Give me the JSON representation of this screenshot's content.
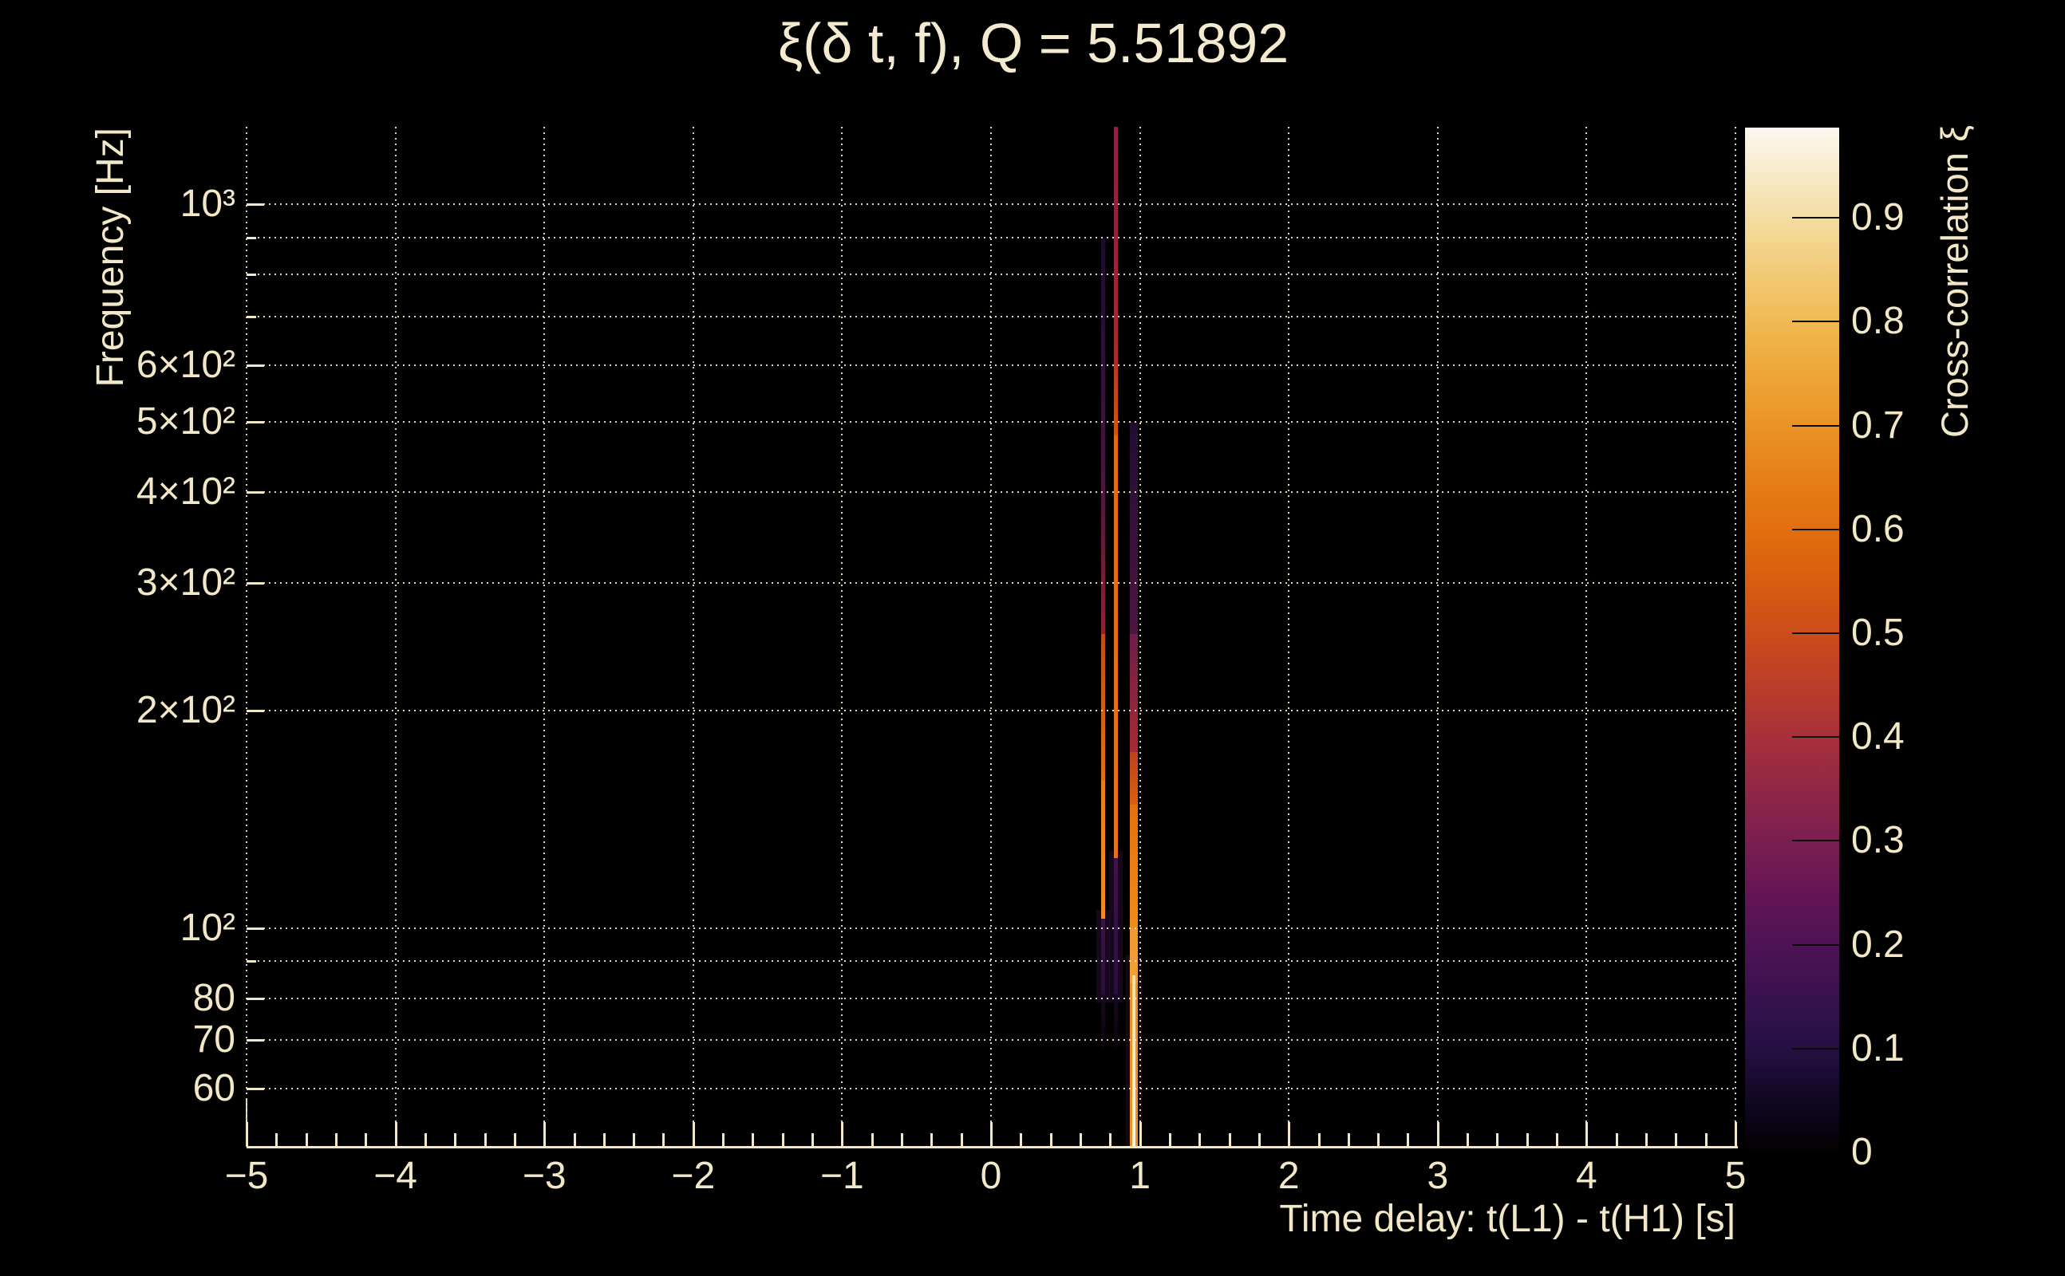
{
  "style": {
    "background": "#000000",
    "text_color": "#f2e7c6",
    "grid_color": "#f2e8cd",
    "bright_core_color": "#fdf7e4"
  },
  "chart_data": {
    "type": "heatmap",
    "title": "ξ(δ t, f), Q = 5.51892",
    "q_value": 5.51892,
    "xlabel": "Time delay: t(L1) - t(H1) [s]",
    "ylabel": "Frequency [Hz]",
    "zlabel": "Cross-correlation ξ",
    "x_range": [
      -5,
      5
    ],
    "x_minor_step": 0.2,
    "x_major_ticks": [
      {
        "t": -5,
        "label": "−5"
      },
      {
        "t": -4,
        "label": "−4"
      },
      {
        "t": -3,
        "label": "−3"
      },
      {
        "t": -2,
        "label": "−2"
      },
      {
        "t": -1,
        "label": "−1"
      },
      {
        "t": 0,
        "label": "0"
      },
      {
        "t": 1,
        "label": "1"
      },
      {
        "t": 2,
        "label": "2"
      },
      {
        "t": 3,
        "label": "3"
      },
      {
        "t": 4,
        "label": "4"
      },
      {
        "t": 5,
        "label": "5"
      }
    ],
    "y_scale": "log",
    "y_range_hz": [
      50,
      1280
    ],
    "y_ticks": [
      {
        "f": 1000,
        "label": "10³"
      },
      {
        "f": 900,
        "label": ""
      },
      {
        "f": 800,
        "label": ""
      },
      {
        "f": 700,
        "label": ""
      },
      {
        "f": 600,
        "label": "6×10²"
      },
      {
        "f": 500,
        "label": "5×10²"
      },
      {
        "f": 400,
        "label": "4×10²"
      },
      {
        "f": 300,
        "label": "3×10²"
      },
      {
        "f": 200,
        "label": "2×10²"
      },
      {
        "f": 100,
        "label": "10²"
      },
      {
        "f": 90,
        "label": ""
      },
      {
        "f": 80,
        "label": "80"
      },
      {
        "f": 70,
        "label": "70"
      },
      {
        "f": 60,
        "label": "60"
      }
    ],
    "grid": true,
    "colorbar": {
      "min": 0,
      "max": 0.987,
      "ticks": [
        {
          "v": 0.9,
          "label": "0.9",
          "tick": true
        },
        {
          "v": 0.8,
          "label": "0.8",
          "tick": true
        },
        {
          "v": 0.7,
          "label": "0.7",
          "tick": true
        },
        {
          "v": 0.6,
          "label": "0.6",
          "tick": true
        },
        {
          "v": 0.5,
          "label": "0.5",
          "tick": true
        },
        {
          "v": 0.4,
          "label": "0.4",
          "tick": true
        },
        {
          "v": 0.3,
          "label": "0.3",
          "tick": true
        },
        {
          "v": 0.2,
          "label": "0.2",
          "tick": true
        },
        {
          "v": 0.1,
          "label": "0.1",
          "tick": true
        },
        {
          "v": 0,
          "label": "0",
          "tick": false
        }
      ],
      "gradient": [
        [
          0.0,
          "#020102"
        ],
        [
          0.05,
          "#110723"
        ],
        [
          0.1,
          "#241041"
        ],
        [
          0.15,
          "#38124e"
        ],
        [
          0.2,
          "#4d1354"
        ],
        [
          0.25,
          "#631555"
        ],
        [
          0.3,
          "#791e51"
        ],
        [
          0.35,
          "#8f2647"
        ],
        [
          0.4,
          "#a52f3b"
        ],
        [
          0.45,
          "#b93c2b"
        ],
        [
          0.5,
          "#ca4a1c"
        ],
        [
          0.55,
          "#d75b11"
        ],
        [
          0.6,
          "#e06c0e"
        ],
        [
          0.65,
          "#e67d14"
        ],
        [
          0.7,
          "#ea8f21"
        ],
        [
          0.75,
          "#eda233"
        ],
        [
          0.8,
          "#f0b54c"
        ],
        [
          0.85,
          "#f2c770"
        ],
        [
          0.9,
          "#f3d997"
        ],
        [
          0.95,
          "#f6e9c4"
        ],
        [
          1.0,
          "#fbf8f0"
        ]
      ]
    },
    "tiles": [
      {
        "t": 0.755,
        "width": 17,
        "f_top": 106,
        "f_bot": 79,
        "color": "rgba(44,18,58,0.45)"
      },
      {
        "t": 0.841,
        "width": 17,
        "f_top": 128,
        "f_bot": 79,
        "color": "rgba(44,18,58,0.45)"
      },
      {
        "t": 0.959,
        "width": 20,
        "f_top": 92,
        "f_bot": 50,
        "color": "rgba(62,22,52,0.35)"
      }
    ],
    "streaks": [
      {
        "name": "streak-t0.76",
        "t": 0.755,
        "width": 5,
        "segments": [
          {
            "f_top": 900,
            "f_bot": 600,
            "c_top": "#1d0b2e",
            "c_bot": "#2f113a"
          },
          {
            "f_top": 600,
            "f_bot": 410,
            "c_top": "#2f113a",
            "c_bot": "#4a163e"
          },
          {
            "f_top": 410,
            "f_bot": 255,
            "c_top": "#4a163e",
            "c_bot": "#8c2532"
          },
          {
            "f_top": 255,
            "f_bot": 160,
            "c_top": "#bf4d1d",
            "c_bot": "#e07016"
          },
          {
            "f_top": 160,
            "f_bot": 103,
            "c_top": "#e87e1a",
            "c_bot": "#f08c22"
          },
          {
            "f_top": 103,
            "f_bot": 81,
            "c_top": "#3c1246",
            "c_bot": "#261038"
          },
          {
            "f_top": 81,
            "f_bot": 68,
            "c_top": "#190a22",
            "c_bot": "#070309"
          }
        ]
      },
      {
        "name": "streak-t0.84",
        "t": 0.841,
        "width": 5,
        "segments": [
          {
            "f_top": 1280,
            "f_bot": 950,
            "c_top": "#8e2144",
            "c_bot": "#93203c"
          },
          {
            "f_top": 950,
            "f_bot": 600,
            "c_top": "#93203c",
            "c_bot": "#a82c2c"
          },
          {
            "f_top": 600,
            "f_bot": 480,
            "c_top": "#b53a20",
            "c_bot": "#d05613"
          },
          {
            "f_top": 480,
            "f_bot": 125,
            "c_top": "#de6d12",
            "c_bot": "#e47417"
          },
          {
            "f_top": 125,
            "f_bot": 81,
            "c_top": "#41134b",
            "c_bot": "#27103a"
          },
          {
            "f_top": 81,
            "f_bot": 68,
            "c_top": "#180a20",
            "c_bot": "#070309"
          }
        ]
      },
      {
        "name": "streak-t0.96",
        "t": 0.959,
        "width": 10,
        "segments": [
          {
            "f_top": 500,
            "f_bot": 255,
            "c_top": "#220c34",
            "c_bot": "#4c1542"
          },
          {
            "f_top": 255,
            "f_bot": 175,
            "c_top": "#701b4a",
            "c_bot": "#a62b31"
          },
          {
            "f_top": 175,
            "f_bot": 148,
            "c_top": "#bc421a",
            "c_bot": "#dc5e0e"
          },
          {
            "f_top": 148,
            "f_bot": 100,
            "c_top": "#e56f0c",
            "c_bot": "#f08d18"
          },
          {
            "f_top": 100,
            "f_bot": 84,
            "c_top": "#f2982e",
            "c_bot": "#f4a037"
          },
          {
            "f_top": 84,
            "f_bot": 50,
            "c_top": "#f09020",
            "c_bot": "#ef9325"
          }
        ]
      },
      {
        "name": "streak-t0.96-core",
        "t": 0.957,
        "width": 4,
        "segments": [
          {
            "f_top": 86,
            "f_bot": 50,
            "c_top": "#f6df9f",
            "c_bot": "#fdf7e4"
          }
        ]
      }
    ]
  }
}
